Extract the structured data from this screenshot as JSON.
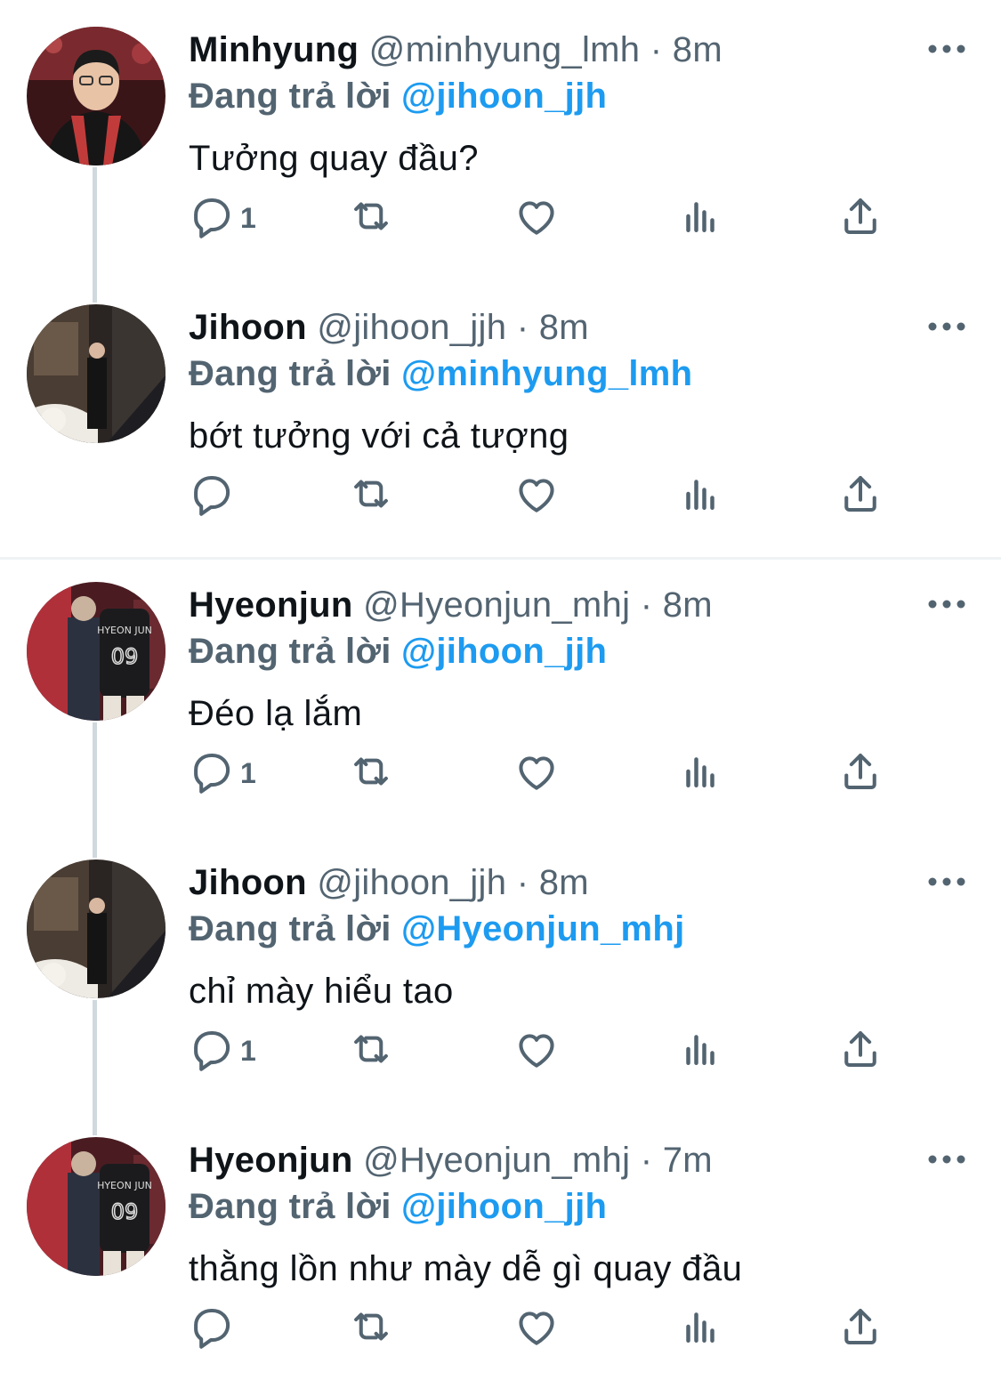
{
  "tweets": [
    {
      "name": "Minhyung",
      "handle": "@minhyung_lmh",
      "dot": "·",
      "time": "8m",
      "reply_label": "Đang trả lời",
      "reply_to": "@jihoon_jjh",
      "text": "Tưởng quay đầu?",
      "reply_count": "1",
      "avatar": "minhyung-avatar"
    },
    {
      "name": "Jihoon",
      "handle": "@jihoon_jjh",
      "dot": "·",
      "time": "8m",
      "reply_label": "Đang trả lời",
      "reply_to": "@minhyung_lmh",
      "text": "bớt tưởng với cả tượng",
      "reply_count": "",
      "avatar": "jihoon-avatar"
    },
    {
      "name": "Hyeonjun",
      "handle": "@Hyeonjun_mhj",
      "dot": "·",
      "time": "8m",
      "reply_label": "Đang trả lời",
      "reply_to": "@jihoon_jjh",
      "text": "Đéo lạ lắm",
      "reply_count": "1",
      "avatar": "hyeonjun-avatar"
    },
    {
      "name": "Jihoon",
      "handle": "@jihoon_jjh",
      "dot": "·",
      "time": "8m",
      "reply_label": "Đang trả lời",
      "reply_to": "@Hyeonjun_mhj",
      "text": "chỉ mày hiểu tao",
      "reply_count": "1",
      "avatar": "jihoon-avatar"
    },
    {
      "name": "Hyeonjun",
      "handle": "@Hyeonjun_mhj",
      "dot": "·",
      "time": "7m",
      "reply_label": "Đang trả lời",
      "reply_to": "@jihoon_jjh",
      "text": "thằng lồn như mày dễ gì quay đầu",
      "reply_count": "",
      "avatar": "hyeonjun-avatar"
    }
  ],
  "icons": {
    "reply": "reply-icon",
    "retweet": "retweet-icon",
    "like": "heart-icon",
    "views": "views-icon",
    "share": "share-icon",
    "more": "more-icon"
  },
  "colors": {
    "text": "#0f1419",
    "secondary": "#536471",
    "accent": "#1d9bf0",
    "thread_line": "#cfd9de",
    "separator": "#eff3f4"
  }
}
